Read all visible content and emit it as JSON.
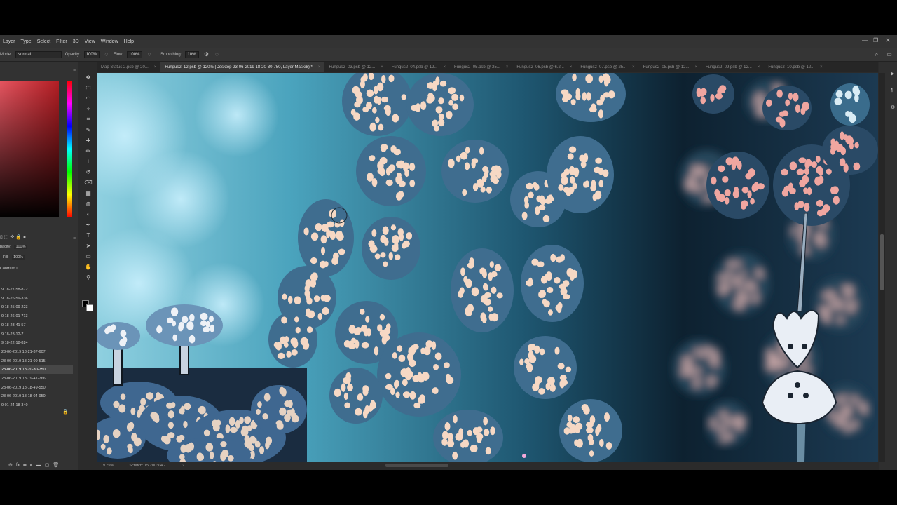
{
  "menubar": {
    "items": [
      "Layer",
      "Type",
      "Select",
      "Filter",
      "3D",
      "View",
      "Window",
      "Help"
    ]
  },
  "options": {
    "mode_label": "Mode:",
    "mode_value": "Normal",
    "opacity_label": "Opacity:",
    "opacity_value": "100%",
    "flow_label": "Flow:",
    "flow_value": "100%",
    "smoothing_label": "Smoothing:",
    "smoothing_value": "10%"
  },
  "tabs": [
    {
      "label": "Map Status 2.psb @ 20...",
      "active": false
    },
    {
      "label": "Fungus2_12.psb @ 120% (Desktop 23-06-2019 18-20-30-750, Layer Mask/8) *",
      "active": true
    },
    {
      "label": "Fungus2_03.psb @ 12...",
      "active": false
    },
    {
      "label": "Fungus2_04.psb @ 12...",
      "active": false
    },
    {
      "label": "Fungus2_05.psb @ 25...",
      "active": false
    },
    {
      "label": "Fungus2_06.psb @ 6.2...",
      "active": false
    },
    {
      "label": "Fungus2_07.psb @ 25...",
      "active": false
    },
    {
      "label": "Fungus2_08.psb @ 12...",
      "active": false
    },
    {
      "label": "Fungus2_09.psb @ 12...",
      "active": false
    },
    {
      "label": "Fungus2_10.psb @ 12...",
      "active": false
    }
  ],
  "layers_panel": {
    "opacity_label": "pacity:",
    "opacity_value": "100%",
    "fill_label": "Fill:",
    "fill_value": "100%",
    "layer_name": "Contrast 1"
  },
  "history": [
    "9 18-27-58-872",
    "9 18-26-59-336",
    "9 18-25-09-223",
    "9 18-26-01-713",
    "9 18-23-41-57",
    "9 18-23-12-7",
    "9 18-22-18-824",
    "23-06-2019 18-21-37-607",
    "23-06-2019 18-21-09-515",
    "23-06-2019 18-20-30-750",
    "23-06-2019 18-19-41-766",
    "23-06-2019 18-18-49-550",
    "23-06-2019 18-18-04-950",
    "9 01-24-18-340"
  ],
  "history_selected": 9,
  "status": {
    "zoom": "119.75%",
    "scratch": "Scratch: 15.20/19.4G"
  },
  "colors": {
    "accent": "#e6505a",
    "canvas_bg": "#1d3a4f",
    "fungus": "#3f6d8f",
    "spot": "#f6d8c4"
  },
  "icons": [
    "move-icon",
    "marquee-icon",
    "lasso-icon",
    "magic-wand-icon",
    "crop-icon",
    "eyedropper-icon",
    "healing-icon",
    "brush-icon",
    "stamp-icon",
    "history-brush-icon",
    "eraser-icon",
    "gradient-icon",
    "blur-icon",
    "dodge-icon",
    "pen-icon",
    "type-icon",
    "path-select-icon",
    "shape-icon",
    "hand-icon",
    "zoom-icon",
    "more-icon"
  ]
}
